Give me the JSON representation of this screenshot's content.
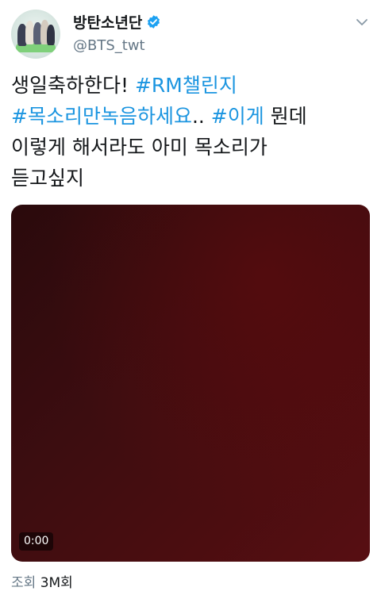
{
  "tweet": {
    "display_name": "방탄소년단",
    "handle": "@BTS_twt",
    "verified": true,
    "lines": [
      [
        {
          "text": "생일축하한다! ",
          "tag": false
        },
        {
          "text": "#RM챌린지",
          "tag": true
        }
      ],
      [
        {
          "text": "#목소리만녹음하세요",
          "tag": true
        },
        {
          "text": ".. ",
          "tag": false
        },
        {
          "text": "#이게",
          "tag": true
        },
        {
          "text": " 뭔데",
          "tag": false
        }
      ],
      [
        {
          "text": "이렇게 해서라도 아미 목소리가",
          "tag": false
        }
      ],
      [
        {
          "text": "듣고싶지",
          "tag": false
        }
      ]
    ]
  },
  "video": {
    "timestamp": "0:00"
  },
  "views": {
    "label": "조회",
    "count": "3M회"
  },
  "colors": {
    "hashtag": "#1b95e0",
    "verified": "#1da1f2",
    "muted": "#657786"
  },
  "icons": {
    "verified": "verified-badge-icon",
    "menu": "chevron-down-icon"
  }
}
